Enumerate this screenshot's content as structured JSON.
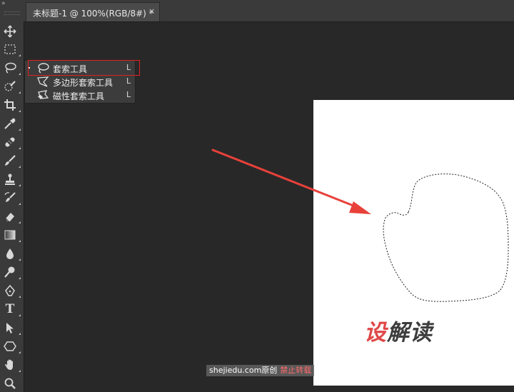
{
  "document_tab": {
    "title": "未标题-1 @ 100%(RGB/8#) *",
    "close": "×"
  },
  "toolbar": {
    "collapse": "»",
    "tools": [
      {
        "name": "move-tool",
        "icon": "move-icon"
      },
      {
        "name": "marquee-tool",
        "icon": "marquee-icon"
      },
      {
        "name": "lasso-tool",
        "icon": "lasso-icon"
      },
      {
        "name": "quick-select-tool",
        "icon": "quick-select-icon"
      },
      {
        "name": "crop-tool",
        "icon": "crop-icon"
      },
      {
        "name": "eyedropper-tool",
        "icon": "eyedropper-icon"
      },
      {
        "name": "healing-brush-tool",
        "icon": "bandage-icon"
      },
      {
        "name": "brush-tool",
        "icon": "brush-icon"
      },
      {
        "name": "clone-stamp-tool",
        "icon": "stamp-icon"
      },
      {
        "name": "history-brush-tool",
        "icon": "history-brush-icon"
      },
      {
        "name": "eraser-tool",
        "icon": "eraser-icon"
      },
      {
        "name": "gradient-tool",
        "icon": "gradient-icon"
      },
      {
        "name": "blur-tool",
        "icon": "drop-icon"
      },
      {
        "name": "dodge-tool",
        "icon": "dodge-icon"
      },
      {
        "name": "pen-tool",
        "icon": "pen-icon"
      },
      {
        "name": "type-tool",
        "icon": "type-icon"
      },
      {
        "name": "path-select-tool",
        "icon": "arrow-select-icon"
      },
      {
        "name": "shape-tool",
        "icon": "polygon-icon"
      },
      {
        "name": "hand-tool",
        "icon": "hand-icon"
      },
      {
        "name": "zoom-tool",
        "icon": "zoom-icon"
      }
    ],
    "type_glyph": "T"
  },
  "flyout": {
    "items": [
      {
        "label": "套索工具",
        "key": "L",
        "icon": "lasso-icon",
        "selected": true
      },
      {
        "label": "多边形套索工具",
        "key": "L",
        "icon": "polygon-lasso-icon",
        "selected": false
      },
      {
        "label": "磁性套索工具",
        "key": "L",
        "icon": "magnetic-lasso-icon",
        "selected": false
      }
    ]
  },
  "canvas": {
    "brand_red": "设",
    "brand_dark": "解读",
    "watermark_site": "shejiedu.com原创",
    "watermark_notice": "禁止转载"
  },
  "colors": {
    "annotation_red": "#e02020",
    "arrow_red": "#e8413a",
    "brand_red": "#e04848"
  }
}
